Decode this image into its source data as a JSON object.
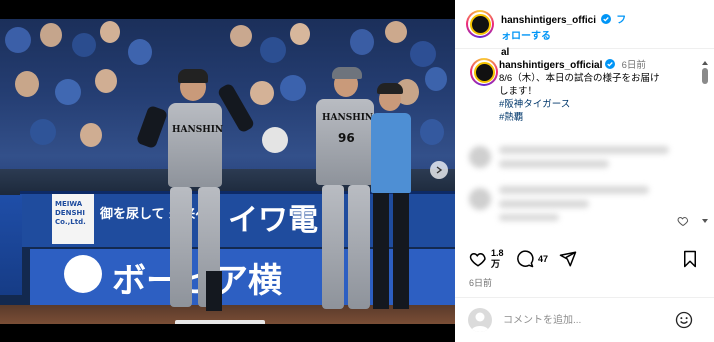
{
  "post": {
    "username": "hanshintigers_official",
    "header_username_line1": "hanshintigers_offici",
    "header_username_line2": "al",
    "follow_label": "フォローする",
    "more_label": "•••",
    "caption_username": "hanshintigers_official",
    "caption_time": "6日前",
    "caption_text_line1": "8/6（木）、本日の試合の様子をお届け",
    "caption_text_line2": "します！",
    "hashtags": [
      "#阪神タイガース",
      "#熱覇"
    ],
    "like_count_line1": "1.8",
    "like_count_line2": "万",
    "comment_count": "47",
    "posted_ago": "6日前",
    "comment_placeholder": "コメントを追加..."
  },
  "photo": {
    "ad_board_top": "御を尿して 未来ヘッ",
    "ad_board_top_right": "イワ電",
    "ad_board_bottom": "ボーピア横",
    "ad_small_line1": "MEIWA",
    "ad_small_line2": "DENSHI",
    "ad_small_line3": "Co.,Ltd.",
    "jersey_player": "HANSHIN",
    "jersey_coach": "HANSHIN",
    "coach_number": "96"
  },
  "icons": {
    "verified": "verified-badge-icon",
    "heart": "heart-icon",
    "comment": "comment-icon",
    "share": "share-icon",
    "bookmark": "bookmark-icon",
    "emoji": "emoji-icon",
    "next": "chevron-right-icon"
  },
  "colors": {
    "accent": "#0095f6",
    "hashtag": "#00376b",
    "muted": "#737373",
    "tigers_yellow": "#f4c300"
  }
}
